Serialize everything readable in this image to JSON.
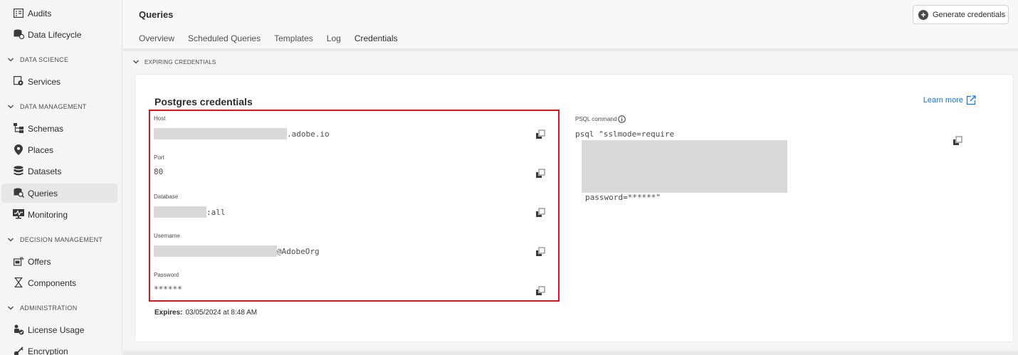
{
  "sidebar": {
    "items": [
      {
        "label": "Audits",
        "icon": "audits-icon"
      },
      {
        "label": "Data Lifecycle",
        "icon": "data-lifecycle-icon"
      },
      {
        "label": "Services",
        "icon": "services-icon"
      },
      {
        "label": "Schemas",
        "icon": "schemas-icon"
      },
      {
        "label": "Places",
        "icon": "places-icon"
      },
      {
        "label": "Datasets",
        "icon": "datasets-icon"
      },
      {
        "label": "Queries",
        "icon": "queries-icon",
        "active": true
      },
      {
        "label": "Monitoring",
        "icon": "monitoring-icon"
      },
      {
        "label": "Offers",
        "icon": "offers-icon"
      },
      {
        "label": "Components",
        "icon": "components-icon"
      },
      {
        "label": "License Usage",
        "icon": "license-usage-icon"
      },
      {
        "label": "Encryption",
        "icon": "encryption-icon"
      }
    ],
    "sections": [
      {
        "label": "DATA SCIENCE"
      },
      {
        "label": "DATA MANAGEMENT"
      },
      {
        "label": "DECISION MANAGEMENT"
      },
      {
        "label": "ADMINISTRATION"
      }
    ]
  },
  "header": {
    "title": "Queries",
    "generate_label": "Generate credentials",
    "tabs": [
      {
        "label": "Overview"
      },
      {
        "label": "Scheduled Queries"
      },
      {
        "label": "Templates"
      },
      {
        "label": "Log"
      },
      {
        "label": "Credentials",
        "active": true
      }
    ]
  },
  "expiring": {
    "label": "EXPIRING CREDENTIALS"
  },
  "card": {
    "title": "Postgres credentials",
    "learn_more": "Learn more",
    "fields": {
      "host": {
        "label": "Host",
        "value": ".adobe.io"
      },
      "port": {
        "label": "Port",
        "value": "80"
      },
      "database": {
        "label": "Database",
        "value": ":all"
      },
      "username": {
        "label": "Username",
        "value": "@AdobeOrg"
      },
      "password": {
        "label": "Password",
        "value": "******"
      }
    },
    "psql": {
      "label": "PSQL command",
      "command_start": "psql \"sslmode=require",
      "command_end": "password=******\""
    },
    "expires": {
      "label": "Expires:",
      "value": "03/05/2024 at 8:48 AM"
    }
  },
  "colors": {
    "accent": "#1473e6",
    "highlight_border": "#d7131e"
  }
}
